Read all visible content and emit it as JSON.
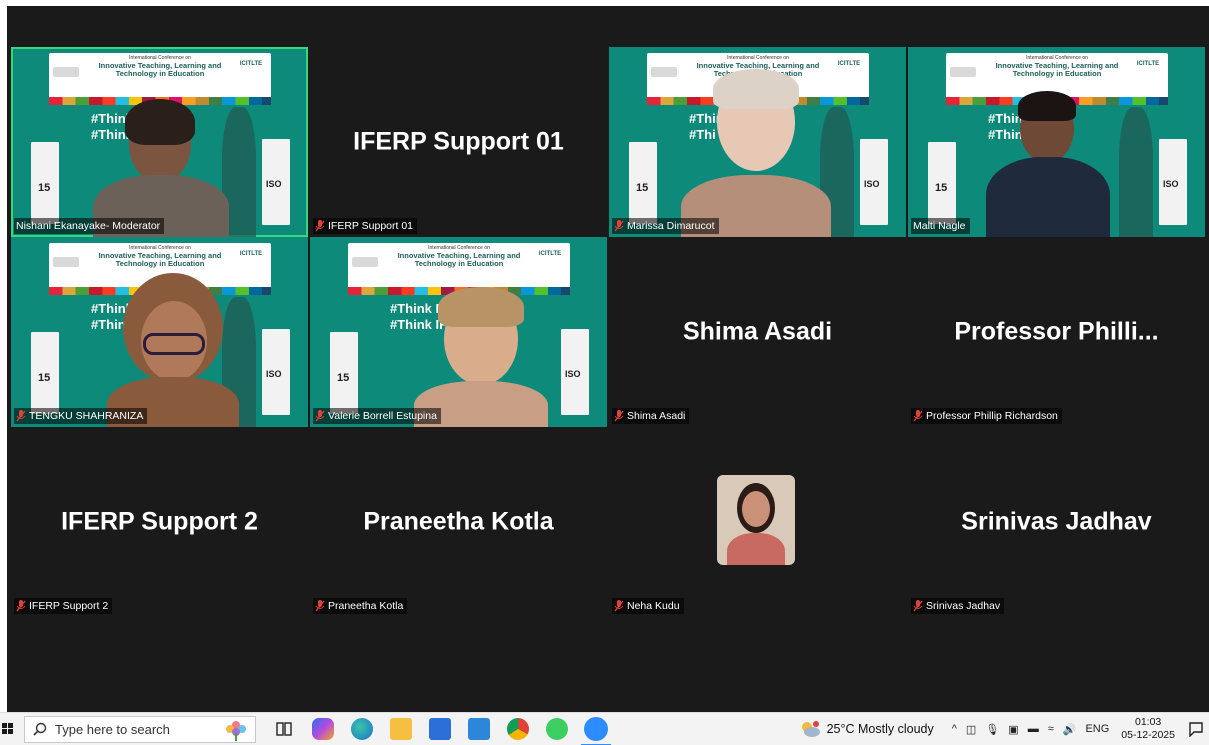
{
  "tiles": [
    {
      "name_tag": "Nishani Ekanayake- Moderator",
      "video": true,
      "active": true,
      "hashtags": [
        "#Think R",
        "#Think"
      ]
    },
    {
      "name_tag": "IFERP Support 01",
      "big_name": "IFERP Support 01",
      "video": false
    },
    {
      "name_tag": "Marissa Dimarucot",
      "video": true,
      "hashtags": [
        "#Think",
        "#Thi"
      ]
    },
    {
      "name_tag": "Malti Nagle",
      "video": true,
      "hashtags": [
        "#Thin",
        "#Thin"
      ]
    },
    {
      "name_tag": "TENGKU SHAHRANIZA",
      "video": true,
      "hashtags": [
        "#Think",
        "#Thin"
      ]
    },
    {
      "name_tag": "Valerie Borrell Estupina",
      "video": true,
      "hashtags": [
        "#Think Resea",
        "#Think IFERP"
      ]
    },
    {
      "name_tag": "Shima Asadi",
      "big_name": "Shima Asadi",
      "video": false
    },
    {
      "name_tag": "Professor Phillip Richardson",
      "big_name": "Professor  Philli...",
      "video": false
    },
    {
      "name_tag": "IFERP Support 2",
      "big_name": "IFERP Support 2",
      "video": false
    },
    {
      "name_tag": "Praneetha Kotla",
      "big_name": "Praneetha Kotla",
      "video": false
    },
    {
      "name_tag": "Neha Kudu",
      "video": false,
      "avatar": true
    },
    {
      "name_tag": "Srinivas Jadhav",
      "big_name": "Srinivas Jadhav",
      "video": false
    }
  ],
  "backdrop": {
    "conference_label": "International Conference on",
    "conference_title": "Innovative Teaching, Learning and Technology in Education",
    "acronym": "ICITLTE",
    "rollup_left_number": "15",
    "rollup_right_text": "ISO"
  },
  "taskbar": {
    "search_placeholder": "Type here to search",
    "weather": "25°C  Mostly cloudy",
    "language": "ENG",
    "time": "01:03",
    "date": "05-12-2025"
  },
  "colors": {
    "meeting_bg": "#1a1a1a",
    "backdrop_teal": "#0d8a7a",
    "active_border": "#37d67a",
    "muted_red": "#e0413a",
    "zoom_blue": "#2d8cff"
  }
}
